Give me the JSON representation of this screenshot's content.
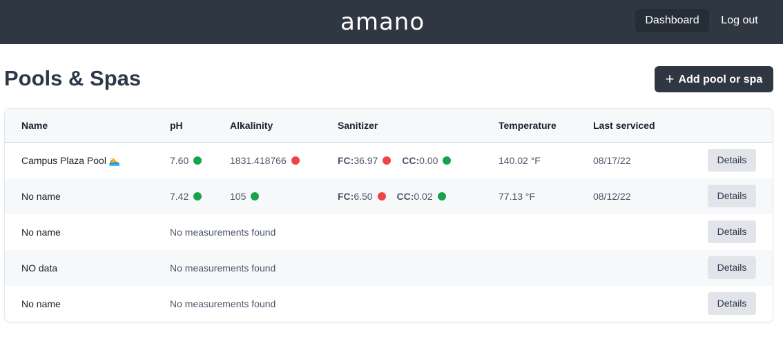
{
  "navbar": {
    "logo": "amano",
    "links": [
      {
        "label": "Dashboard",
        "active": true
      },
      {
        "label": "Log out",
        "active": false
      }
    ]
  },
  "page": {
    "title": "Pools & Spas",
    "add_button": {
      "icon": "plus-icon",
      "label": "Add pool or spa"
    }
  },
  "colors": {
    "navbar_bg": "#2f3842",
    "status_ok": "#16a34a",
    "status_bad": "#ef4444"
  },
  "table": {
    "columns": [
      "Name",
      "pH",
      "Alkalinity",
      "Sanitizer",
      "Temperature",
      "Last serviced"
    ],
    "rows": [
      {
        "name": "Campus Plaza Pool",
        "emoji": "🏊",
        "ph": "7.60",
        "ph_status": "ok",
        "alkalinity": "1831.418766",
        "alkalinity_status": "bad",
        "fc_label": "FC:",
        "fc": "36.97",
        "fc_status": "bad",
        "cc_label": "CC:",
        "cc": "0.00",
        "cc_status": "ok",
        "temperature": "140.02 °F",
        "last_serviced": "08/17/22",
        "details_label": "Details"
      },
      {
        "name": "No name",
        "ph": "7.42",
        "ph_status": "ok",
        "alkalinity": "105",
        "alkalinity_status": "ok",
        "fc_label": "FC:",
        "fc": "6.50",
        "fc_status": "bad",
        "cc_label": "CC:",
        "cc": "0.02",
        "cc_status": "ok",
        "temperature": "77.13 °F",
        "last_serviced": "08/12/22",
        "details_label": "Details"
      },
      {
        "name": "No name",
        "empty_message": "No measurements found",
        "details_label": "Details"
      },
      {
        "name": "NO data",
        "empty_message": "No measurements found",
        "details_label": "Details"
      },
      {
        "name": "No name",
        "empty_message": "No measurements found",
        "details_label": "Details"
      }
    ]
  }
}
